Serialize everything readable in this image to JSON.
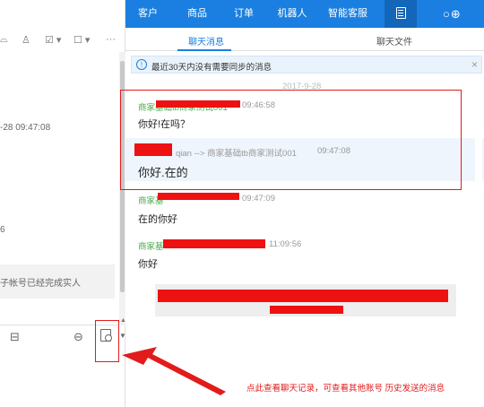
{
  "topbar": {
    "nav": [
      "客户",
      "商品",
      "订单",
      "机器人",
      "智能客服"
    ],
    "active_icon": "document-icon",
    "right_icons": "○⊕"
  },
  "left": {
    "toolbar_icons": [
      "phone-icon",
      "add-contact-icon",
      "screenshot-icon",
      "video-icon",
      "more-icon"
    ],
    "toolbar_glyphs": [
      "⌓",
      "♙",
      "☑ ▾",
      "☐ ▾",
      "···"
    ],
    "timestamp": "-28 09:47:08",
    "item_digit": "6",
    "item_text": "子帐号已经完成实人",
    "bottom_icons": [
      "⊟",
      "⊖"
    ]
  },
  "tabs": {
    "chat": "聊天消息",
    "files": "聊天文件"
  },
  "notice": {
    "text": "最近30天内没有需要同步的消息",
    "info_glyph": "!",
    "close": "×"
  },
  "date": "2017-9-28",
  "messages": [
    {
      "sender": "商家基础tb商家测试001",
      "time": "09:46:58",
      "text": "你好!在吗？"
    },
    {
      "sender": "qian --> 商家基础tb商家测试001",
      "time": "09:47:08",
      "text": "你好.在的"
    },
    {
      "sender": "商家基",
      "time": "09:47:09",
      "text": "在的你好"
    },
    {
      "sender": "商家基",
      "time": "11:09:56",
      "text": "你好"
    }
  ],
  "annotation": "点此查看聊天记录，可查看其他账号 历史发送的消息",
  "colors": {
    "brand": "#1a7fe0",
    "annotation_red": "#e21b1b",
    "sender_green": "#4aa84a"
  }
}
